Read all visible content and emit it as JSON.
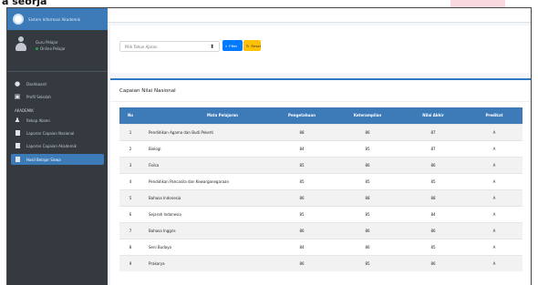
{
  "page": {
    "caption": "a seorja"
  },
  "brand": {
    "title": "Sistem Informasi Akademik"
  },
  "user": {
    "name": "Guru Pelajar",
    "status": "Online Pelajar"
  },
  "sidebar": {
    "items": [
      {
        "label": "Dashboard",
        "icon": "dashboard-icon"
      },
      {
        "label": "Profil Sekolah",
        "icon": "school-icon"
      },
      {
        "label": "AKADEMIK",
        "icon": ""
      },
      {
        "label": "Rekap Absen",
        "icon": "users-icon"
      },
      {
        "label": "Laporan Capaian Nasional",
        "icon": "square-icon"
      },
      {
        "label": "Laporan Capaian Akademik",
        "icon": "square-icon"
      },
      {
        "label": "Hasil Belajar Siswa",
        "icon": "book-icon"
      }
    ]
  },
  "filter": {
    "select_value": "Pilih Tahun Ajaran",
    "filter_label": "Filter",
    "reset_label": "Reset"
  },
  "table": {
    "title": "Capaian Nilai Nasional",
    "headers": [
      "No",
      "Mata Pelajaran",
      "Pengetahuan",
      "Keterampilan",
      "Nilai Akhir",
      "Predikat"
    ],
    "rows": [
      [
        "1",
        "Pendidikan Agama dan Budi Pekerti",
        "88",
        "86",
        "87",
        "A"
      ],
      [
        "2",
        "Biologi",
        "84",
        "85",
        "87",
        "A"
      ],
      [
        "3",
        "Fisika",
        "85",
        "86",
        "86",
        "A"
      ],
      [
        "4",
        "Pendidikan Pancasila dan Kewarganegaraan",
        "85",
        "85",
        "85",
        "A"
      ],
      [
        "5",
        "Bahasa Indonesia",
        "86",
        "88",
        "88",
        "A"
      ],
      [
        "6",
        "Sejarah Indonesia",
        "85",
        "85",
        "84",
        "A"
      ],
      [
        "7",
        "Bahasa Inggris",
        "86",
        "86",
        "86",
        "A"
      ],
      [
        "8",
        "Seni Budaya",
        "84",
        "86",
        "85",
        "A"
      ],
      [
        "9",
        "Prakarya",
        "86",
        "85",
        "86",
        "A"
      ]
    ]
  },
  "colors": {
    "sidebar": "#343a40",
    "primary": "#3d7ab8",
    "button_primary": "#007bff",
    "button_warning": "#ffc107"
  }
}
